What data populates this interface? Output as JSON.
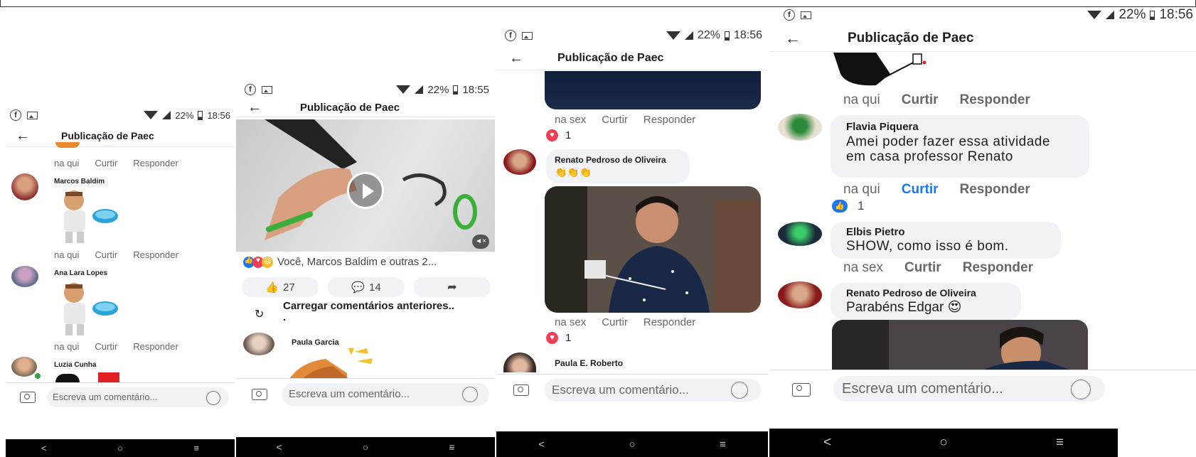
{
  "status": {
    "battery": "22%",
    "time_1": "18:56",
    "time_2": "18:55",
    "time_3": "18:56",
    "time_4": "18:56"
  },
  "header_title": "Publicação de Paec",
  "actions": {
    "like": "Curtir",
    "reply": "Responder"
  },
  "input_placeholder": "Escreva um comentário...",
  "nav": {
    "back": "<",
    "home": "○",
    "menu": "≡"
  },
  "phone1": {
    "comments": [
      {
        "time": "na qui",
        "name": "Marcos Baldim"
      },
      {
        "time": "na qui",
        "name": "Ana Lara Lopes"
      },
      {
        "time": "na qui",
        "name": "Luzia Cunha"
      }
    ]
  },
  "phone2": {
    "reaction_summary": "Você, Marcos Baldim e outras 2...",
    "like_count": "27",
    "comment_count": "14",
    "load_more": "Carregar comentários anteriores..",
    "load_more_dot": ".",
    "commenter": "Paula Garcia"
  },
  "phone3": {
    "first_time": "na sex",
    "first_reactions": "1",
    "commenter": "Renato Pedroso de Oliveira",
    "emoji_comment": "👏👏👏",
    "second_time": "na sex",
    "second_reactions": "1",
    "last_commenter": "Paula E. Roberto"
  },
  "phone4": {
    "top_time": "na qui",
    "c1": {
      "name": "Flavia Piquera",
      "text": "Amei poder fazer essa atividade em casa professor Renato",
      "time": "na qui",
      "reactions": "1"
    },
    "c2": {
      "name": "Elbis Pietro",
      "text": "SHOW, como isso é bom.",
      "time": "na sex"
    },
    "c3": {
      "name": "Renato Pedroso de Oliveira",
      "text": "Parabéns Edgar 😍"
    }
  }
}
